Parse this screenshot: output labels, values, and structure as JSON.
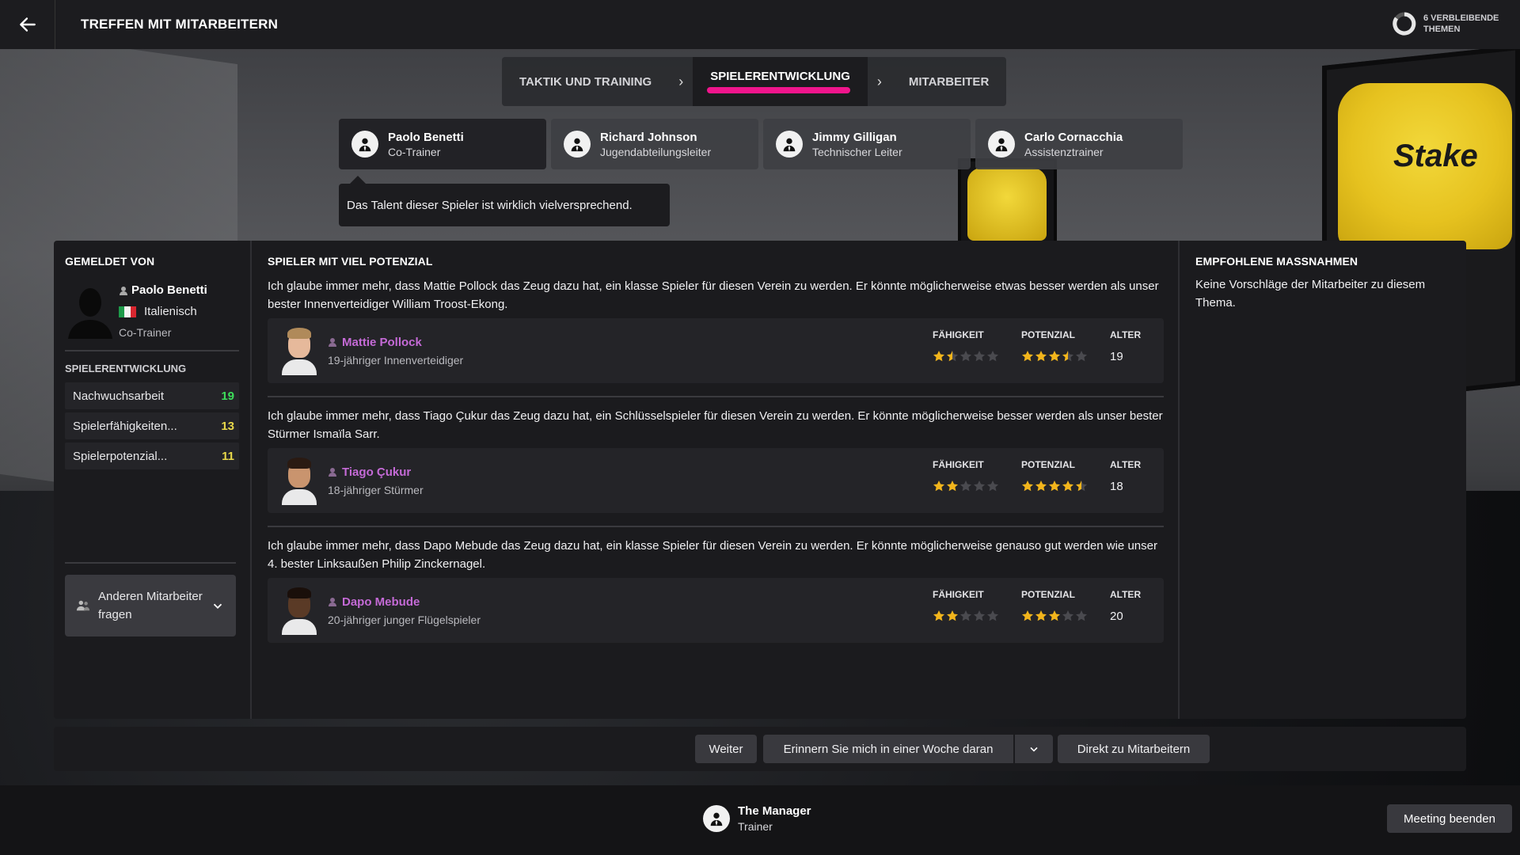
{
  "header": {
    "title": "TREFFEN MIT MITARBEITERN",
    "topics_remaining": "6 VERBLEIBENDE THEMEN"
  },
  "stages": [
    {
      "label": "TAKTIK UND TRAINING",
      "active": false
    },
    {
      "label": "SPIELERENTWICKLUNG",
      "active": true
    },
    {
      "label": "MITARBEITER",
      "active": false
    }
  ],
  "staff": [
    {
      "name": "Paolo Benetti",
      "role": "Co-Trainer",
      "active": true
    },
    {
      "name": "Richard Johnson",
      "role": "Jugendabteilungsleiter",
      "active": false
    },
    {
      "name": "Jimmy Gilligan",
      "role": "Technischer Leiter",
      "active": false
    },
    {
      "name": "Carlo Cornacchia",
      "role": "Assistenztrainer",
      "active": false
    }
  ],
  "speech": "Das Talent dieser Spieler ist wirklich vielversprechend.",
  "reported_by": {
    "heading": "GEMELDET VON",
    "name": "Paolo Benetti",
    "nationality": "Italienisch",
    "role": "Co-Trainer",
    "section": "SPIELERENTWICKLUNG",
    "attributes": [
      {
        "label": "Nachwuchsarbeit",
        "value": "19",
        "color": "#3ddc5a"
      },
      {
        "label": "Spielerfähigkeiten...",
        "value": "13",
        "color": "#e8d84a"
      },
      {
        "label": "Spielerpotenzial...",
        "value": "11",
        "color": "#e8d84a"
      }
    ],
    "ask_label": "Anderen Mitarbeiter fragen"
  },
  "main": {
    "heading": "SPIELER MIT VIEL POTENZIAL",
    "col_ability": "FÄHIGKEIT",
    "col_potential": "POTENZIAL",
    "col_age": "ALTER",
    "players": [
      {
        "text": "Ich glaube immer mehr, dass Mattie Pollock das Zeug dazu hat, ein klasse Spieler für diesen Verein zu werden. Er könnte möglicherweise etwas besser werden als unser bester Innenverteidiger William Troost-Ekong.",
        "name": "Mattie Pollock",
        "desc": "19-jähriger Innenverteidiger",
        "ability": 1.5,
        "potential": 3.5,
        "age": "19",
        "skin": "#e6b99b",
        "hair": "#b08a5a"
      },
      {
        "text": "Ich glaube immer mehr, dass Tiago Çukur das Zeug dazu hat, ein Schlüsselspieler für diesen Verein zu werden. Er könnte möglicherweise besser werden als unser bester Stürmer Ismaïla Sarr.",
        "name": "Tiago Çukur",
        "desc": "18-jähriger Stürmer",
        "ability": 2,
        "potential": 4.5,
        "age": "18",
        "skin": "#c9946e",
        "hair": "#2a1a12"
      },
      {
        "text": "Ich glaube immer mehr, dass Dapo Mebude das Zeug dazu hat, ein klasse Spieler für diesen Verein zu werden. Er könnte möglicherweise genauso gut werden wie unser 4. bester Linksaußen Philip Zinckernagel.",
        "name": "Dapo Mebude",
        "desc": "20-jähriger junger Flügelspieler",
        "ability": 2,
        "potential": 3,
        "age": "20",
        "skin": "#5a3a26",
        "hair": "#1a0f0a"
      }
    ]
  },
  "recommended": {
    "heading": "EMPFOHLENE MASSNAHMEN",
    "text": "Keine Vorschläge der Mitarbeiter zu diesem Thema."
  },
  "actions": {
    "continue": "Weiter",
    "remind": "Erinnern Sie mich in einer Woche daran",
    "direct": "Direkt zu Mitarbeitern"
  },
  "footer": {
    "manager_name": "The Manager",
    "manager_role": "Trainer",
    "end_meeting": "Meeting beenden"
  },
  "colors": {
    "accent": "#f0158c",
    "player_link": "#c46ad6",
    "star": "#f2b51c"
  }
}
